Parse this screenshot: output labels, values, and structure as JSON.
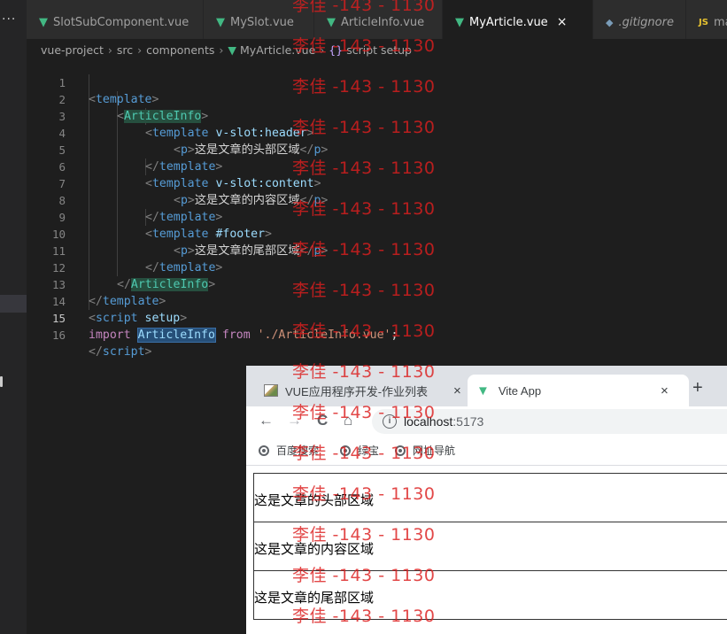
{
  "editor": {
    "tabs": [
      {
        "label": "SlotSubComponent.vue",
        "icon": "vue-icon"
      },
      {
        "label": "MySlot.vue",
        "icon": "vue-icon"
      },
      {
        "label": "ArticleInfo.vue",
        "icon": "vue-icon"
      },
      {
        "label": "MyArticle.vue",
        "icon": "vue-icon",
        "active": true,
        "close": "×"
      },
      {
        "label": ".gitignore",
        "icon": "gitignore-icon",
        "glyph": "◆"
      },
      {
        "label": "main",
        "icon": "js-icon",
        "glyph": "JS"
      }
    ],
    "overflow_glyph": "···",
    "breadcrumb": {
      "items": [
        "vue-project",
        "src",
        "components",
        "MyArticle.vue",
        "script setup"
      ],
      "sep": "›",
      "braces": "{}"
    },
    "line_numbers": [
      "1",
      "2",
      "3",
      "4",
      "5",
      "6",
      "7",
      "8",
      "9",
      "10",
      "11",
      "12",
      "13",
      "14",
      "15",
      "16"
    ],
    "current_line": "15",
    "code": {
      "lt": "<",
      "gt": ">",
      "close_lt": "</",
      "template": "template",
      "article_info": "ArticleInfo",
      "slot_header_attr": "v-slot:header",
      "slot_content_attr": "v-slot:content",
      "slot_footer_attr": "#footer",
      "p": "p",
      "header_text": "这是文章的头部区域",
      "content_text": "这是文章的内容区域",
      "footer_text": "这是文章的尾部区域",
      "script": "script",
      "setup": "setup",
      "import_kw": "import",
      "from_kw": "from",
      "import_path": "'./ArticleInfo.vue'",
      "semicolon": ";"
    }
  },
  "browser": {
    "tabs": [
      {
        "title": "VUE应用程序开发-作业列表",
        "close": "×"
      },
      {
        "title": "Vite App",
        "close": "×",
        "active": true
      }
    ],
    "new_tab": "+",
    "nav": {
      "back": "←",
      "forward": "→",
      "reload": "C",
      "home": "⌂"
    },
    "address": {
      "info": "i",
      "host": "localhost",
      "port": ":5173"
    },
    "bookmarks": [
      "百度搜索",
      "绿宝",
      "网址导航"
    ],
    "page": {
      "header": "这是文章的头部区域",
      "content": "这是文章的内容区域",
      "footer": "这是文章的尾部区域"
    }
  },
  "watermark": {
    "text": "李佳 -143 - 1130"
  },
  "colors": {
    "vue_green": "#42b883",
    "editor_bg": "#1e1e1e",
    "watermark": "#dc1e1e"
  }
}
